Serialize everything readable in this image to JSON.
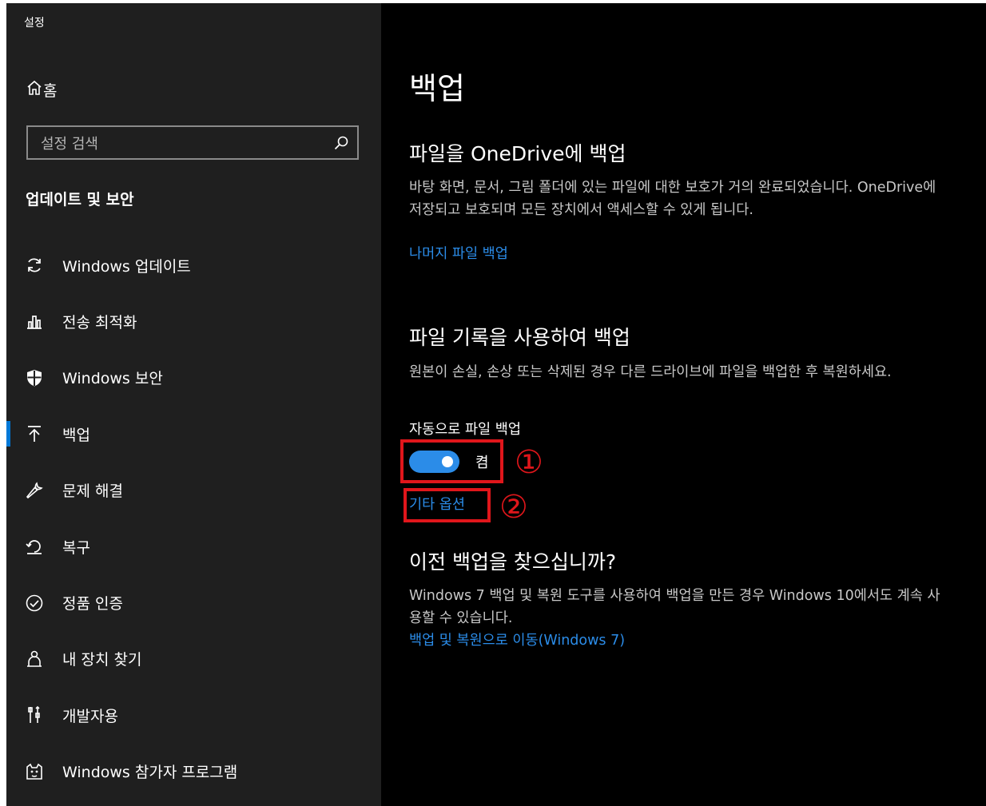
{
  "window": {
    "title": "설정"
  },
  "sidebar": {
    "home_label": "홈",
    "search_placeholder": "설정 검색",
    "section_title": "업데이트 및 보안",
    "items": [
      {
        "label": "Windows 업데이트",
        "icon": "sync-icon"
      },
      {
        "label": "전송 최적화",
        "icon": "delivery-optimization-icon"
      },
      {
        "label": "Windows 보안",
        "icon": "shield-icon"
      },
      {
        "label": "백업",
        "icon": "backup-arrow-icon",
        "selected": true
      },
      {
        "label": "문제 해결",
        "icon": "wrench-icon"
      },
      {
        "label": "복구",
        "icon": "recovery-icon"
      },
      {
        "label": "정품 인증",
        "icon": "check-circle-icon"
      },
      {
        "label": "내 장치 찾기",
        "icon": "person-location-icon"
      },
      {
        "label": "개발자용",
        "icon": "developer-tools-icon"
      },
      {
        "label": "Windows 참가자 프로그램",
        "icon": "insider-cat-icon"
      }
    ]
  },
  "main": {
    "title": "백업",
    "onedrive": {
      "heading": "파일을 OneDrive에 백업",
      "description": "바탕 화면, 문서, 그림 폴더에 있는 파일에 대한 보호가 거의 완료되었습니다. OneDrive에 저장되고 보호되며 모든 장치에서 액세스할 수 있게 됩니다.",
      "link": "나머지 파일 백업"
    },
    "file_history": {
      "heading": "파일 기록을 사용하여 백업",
      "description": "원본이 손실, 손상 또는 삭제된 경우 다른 드라이브에 파일을 백업한 후 복원하세요.",
      "toggle_label": "자동으로 파일 백업",
      "toggle_on": true,
      "toggle_state": "켬",
      "more_options": "기타 옵션"
    },
    "older": {
      "heading": "이전 백업을 찾으십니까?",
      "description": "Windows 7 백업 및 복원 도구를 사용하여 백업을 만든 경우 Windows 10에서도 계속 사용할 수 있습니다.",
      "link": "백업 및 복원으로 이동(Windows 7)"
    }
  },
  "annotations": {
    "badge1": "①",
    "badge2": "②",
    "color": "#e0161b"
  },
  "colors": {
    "accent": "#0078d7",
    "link": "#2b8ce8",
    "sidebar_bg": "#1f1f1f",
    "main_bg": "#000000"
  }
}
